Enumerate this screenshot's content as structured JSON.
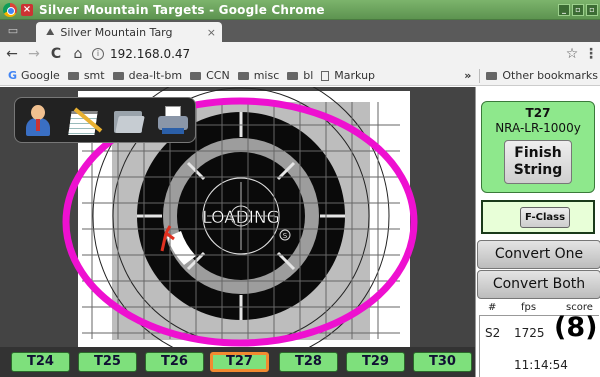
{
  "window": {
    "title": "Silver Mountain Targets - Google Chrome",
    "close_glyph": "×"
  },
  "tab": {
    "title": "Silver Mountain Targ",
    "close_glyph": "×"
  },
  "toolbar": {
    "url": "192.168.0.47",
    "back": "←",
    "forward": "→",
    "reload": "C",
    "home": "⌂",
    "star": "☆",
    "menu": "⋮"
  },
  "bookmarks": {
    "items": [
      "Google",
      "smt",
      "dea-lt-bm",
      "CCN",
      "misc",
      "bl",
      "Markup"
    ],
    "more": "»",
    "other": "Other bookmarks"
  },
  "target": {
    "loading_text": "LOADING",
    "shot_marker_color": "#e03020",
    "overlay_ring_color": "#ee10d0",
    "tools": [
      "user-icon",
      "notepad-icon",
      "folder-icon",
      "printer-icon"
    ]
  },
  "strings": {
    "tabs": [
      "T24",
      "T25",
      "T26",
      "T27",
      "T28",
      "T29",
      "T30"
    ],
    "active": "T27"
  },
  "panel": {
    "target_id": "T27",
    "target_name": "NRA-LR-1000y",
    "finish_line1": "Finish",
    "finish_line2": "String",
    "fclass_label": "F-Class",
    "convert_one": "Convert One",
    "convert_both": "Convert Both",
    "shot_headers": {
      "num": "#",
      "fps": "fps",
      "score": "score"
    },
    "shot": {
      "id": "S2",
      "fps": "1725",
      "score": "(8)",
      "time": "11:14:54"
    }
  }
}
